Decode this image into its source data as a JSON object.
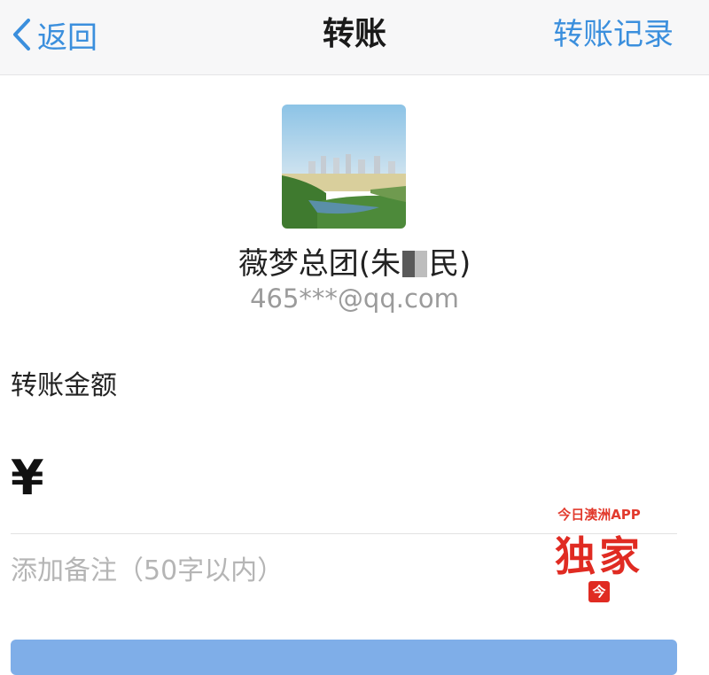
{
  "nav": {
    "back_label": "返回",
    "title": "转账",
    "history_label": "转账记录"
  },
  "recipient": {
    "name_prefix": "薇梦总团(朱",
    "name_suffix": "民)",
    "account": "465***@qq.com"
  },
  "transfer": {
    "amount_label": "转账金额",
    "currency_symbol": "¥",
    "amount_value": "",
    "remark_placeholder": "添加备注（50字以内）"
  },
  "watermark": {
    "caption": "今日澳洲APP",
    "text": "独家",
    "seal": "今"
  },
  "colors": {
    "link": "#3b8fdd",
    "button": "#7faee8",
    "watermark": "#e02b22"
  }
}
